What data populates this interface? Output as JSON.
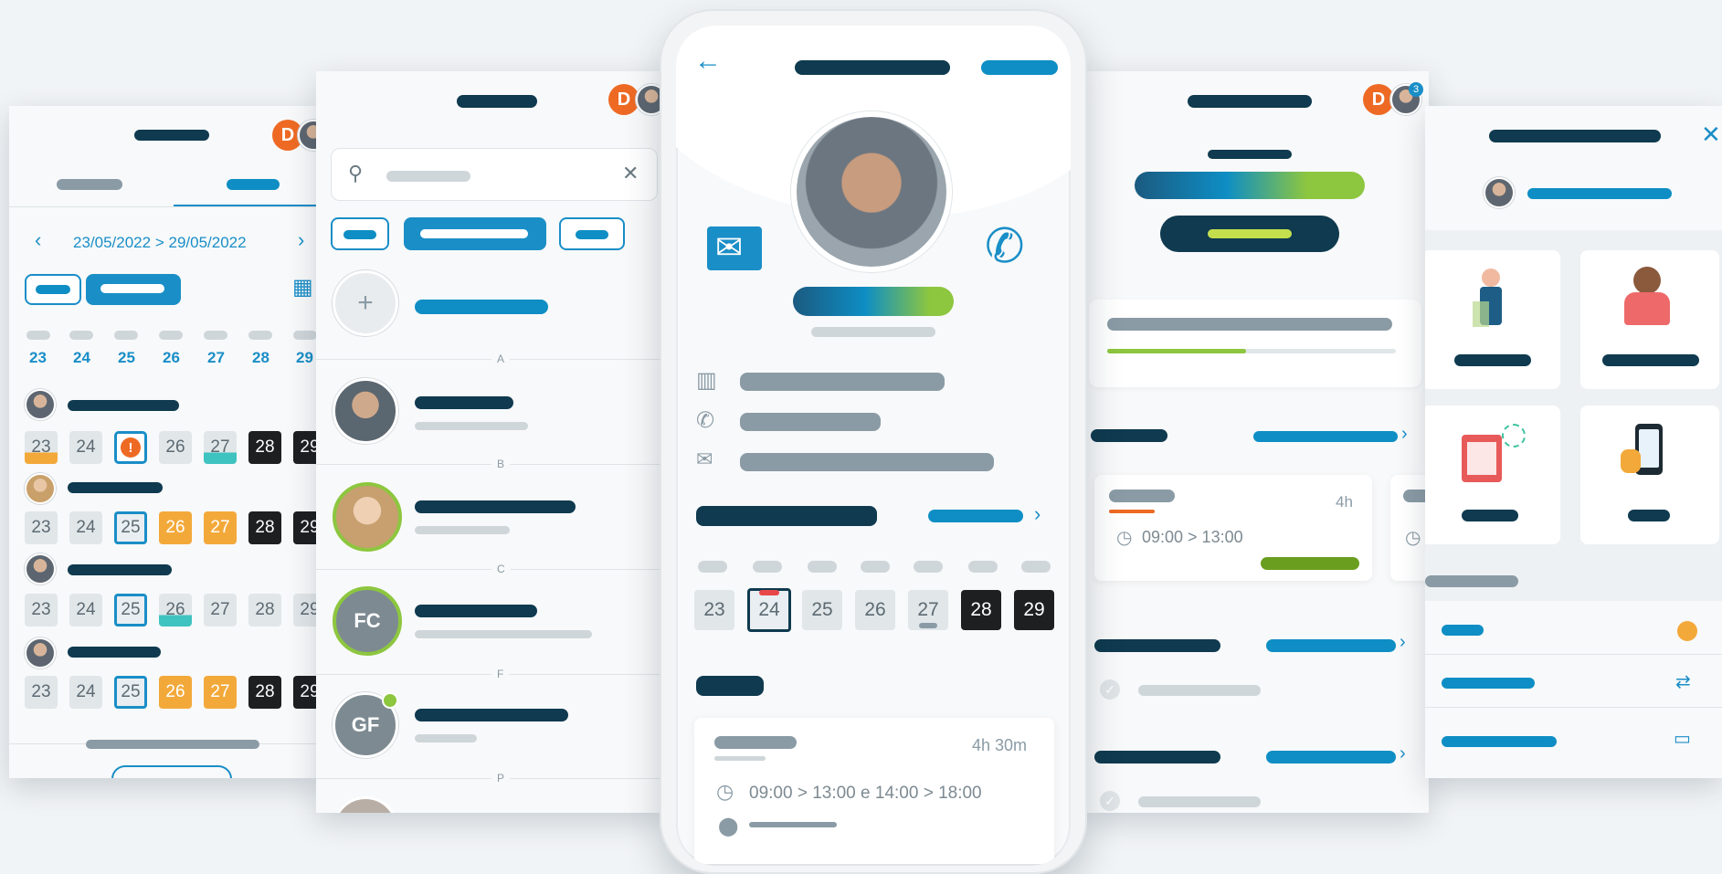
{
  "calendar": {
    "date_range_start": "23/05/2022",
    "separator": ">",
    "date_range_end": "29/05/2022",
    "day_numbers": [
      "23",
      "24",
      "25",
      "26",
      "27",
      "28",
      "29"
    ]
  },
  "contacts": {
    "add_icon": "+",
    "section_letters": [
      "A",
      "B",
      "C",
      "F",
      "P"
    ],
    "initials_fc": "FC",
    "initials_gf": "GF"
  },
  "profile": {
    "week_days": [
      "23",
      "24",
      "25",
      "26",
      "27",
      "28",
      "29"
    ],
    "shift_duration": "4h 30m",
    "shift_time": "09:00 > 13:00 e 14:00 > 18:00"
  },
  "dashboard": {
    "badge_count": "3",
    "card_duration": "4h",
    "card_time": "09:00 > 13:00"
  },
  "colors": {
    "dark": "#0f3a4f",
    "accent": "#0e8ec4",
    "orange": "#ee6a24",
    "green": "#8dc63f"
  }
}
